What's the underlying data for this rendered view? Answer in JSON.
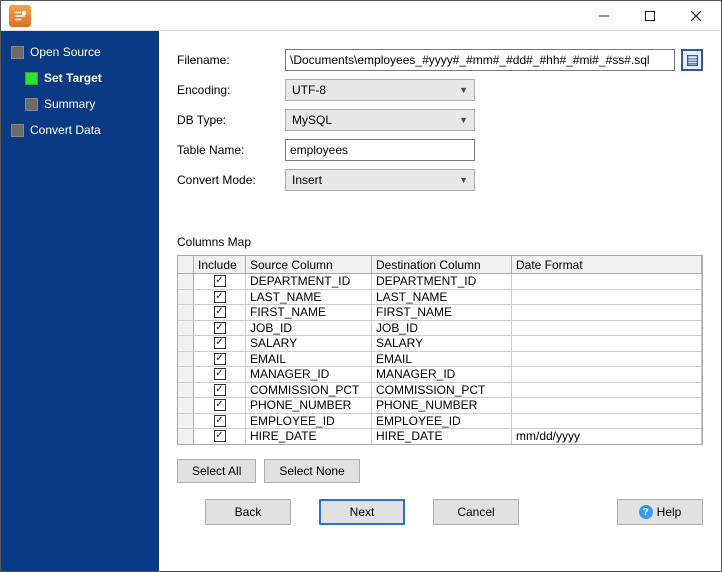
{
  "sidebar": {
    "items": [
      {
        "label": "Open Source",
        "active": false,
        "indent": false
      },
      {
        "label": "Set Target",
        "active": true,
        "indent": true
      },
      {
        "label": "Summary",
        "active": false,
        "indent": true
      },
      {
        "label": "Convert Data",
        "active": false,
        "indent": false
      }
    ]
  },
  "form": {
    "filename_label": "Filename:",
    "filename_value": "\\Documents\\employees_#yyyy#_#mm#_#dd#_#hh#_#mi#_#ss#.sql",
    "encoding_label": "Encoding:",
    "encoding_value": "UTF-8",
    "dbtype_label": "DB Type:",
    "dbtype_value": "MySQL",
    "tablename_label": "Table Name:",
    "tablename_value": "employees",
    "convertmode_label": "Convert Mode:",
    "convertmode_value": "Insert"
  },
  "columns_map": {
    "title": "Columns Map",
    "headers": {
      "include": "Include",
      "source": "Source Column",
      "destination": "Destination Column",
      "date": "Date Format"
    },
    "rows": [
      {
        "inc": true,
        "src": "DEPARTMENT_ID",
        "dst": "DEPARTMENT_ID",
        "date": ""
      },
      {
        "inc": true,
        "src": "LAST_NAME",
        "dst": "LAST_NAME",
        "date": ""
      },
      {
        "inc": true,
        "src": "FIRST_NAME",
        "dst": "FIRST_NAME",
        "date": ""
      },
      {
        "inc": true,
        "src": "JOB_ID",
        "dst": "JOB_ID",
        "date": ""
      },
      {
        "inc": true,
        "src": "SALARY",
        "dst": "SALARY",
        "date": ""
      },
      {
        "inc": true,
        "src": "EMAIL",
        "dst": "EMAIL",
        "date": ""
      },
      {
        "inc": true,
        "src": "MANAGER_ID",
        "dst": "MANAGER_ID",
        "date": ""
      },
      {
        "inc": true,
        "src": "COMMISSION_PCT",
        "dst": "COMMISSION_PCT",
        "date": ""
      },
      {
        "inc": true,
        "src": "PHONE_NUMBER",
        "dst": "PHONE_NUMBER",
        "date": ""
      },
      {
        "inc": true,
        "src": "EMPLOYEE_ID",
        "dst": "EMPLOYEE_ID",
        "date": ""
      },
      {
        "inc": true,
        "src": "HIRE_DATE",
        "dst": "HIRE_DATE",
        "date": "mm/dd/yyyy"
      }
    ]
  },
  "buttons": {
    "select_all": "Select All",
    "select_none": "Select None",
    "back": "Back",
    "next": "Next",
    "cancel": "Cancel",
    "help": "Help"
  }
}
